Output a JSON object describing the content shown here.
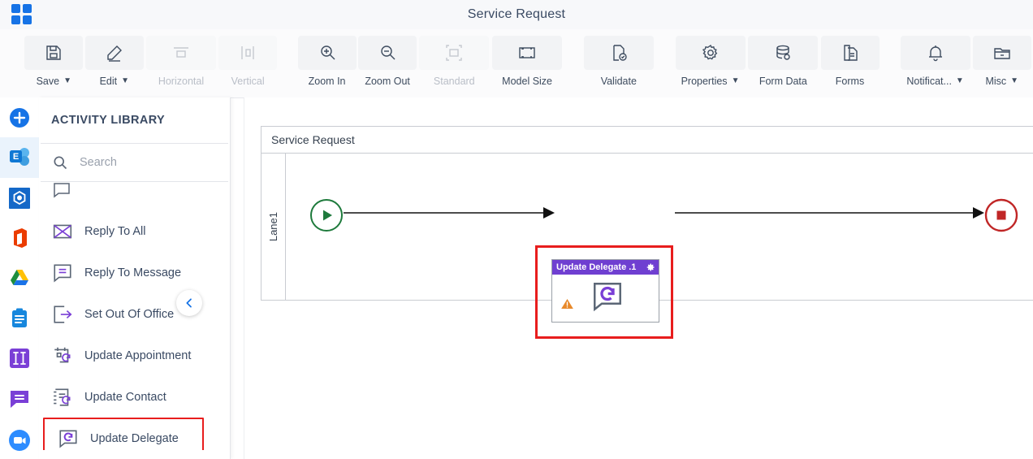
{
  "titlebar": {
    "app_grid_icon": "grid-apps-icon",
    "title": "Service Request"
  },
  "toolbar": {
    "items": [
      {
        "label": "Save",
        "icon": "save-icon",
        "caret": "⌄",
        "disabled": false
      },
      {
        "label": "Edit",
        "icon": "edit-pencil-icon",
        "caret": "⌄",
        "disabled": false
      },
      {
        "label": "Horizontal",
        "icon": "horizontal-align-icon",
        "caret": "",
        "disabled": true
      },
      {
        "label": "Vertical",
        "icon": "vertical-align-icon",
        "caret": "",
        "disabled": true
      },
      {
        "label": "Zoom In",
        "icon": "zoom-in-icon",
        "caret": "",
        "disabled": false
      },
      {
        "label": "Zoom Out",
        "icon": "zoom-out-icon",
        "caret": "",
        "disabled": false
      },
      {
        "label": "Standard",
        "icon": "standard-size-icon",
        "caret": "",
        "disabled": true
      },
      {
        "label": "Model Size",
        "icon": "model-size-icon",
        "caret": "",
        "disabled": false
      },
      {
        "label": "Validate",
        "icon": "validate-icon",
        "caret": "",
        "disabled": false
      },
      {
        "label": "Properties",
        "icon": "gear-icon",
        "caret": "⌄",
        "disabled": false
      },
      {
        "label": "Form Data",
        "icon": "database-icon",
        "caret": "",
        "disabled": false
      },
      {
        "label": "Forms",
        "icon": "document-icon",
        "caret": "",
        "disabled": false
      },
      {
        "label": "Notificat...",
        "icon": "bell-icon",
        "caret": "⌄",
        "disabled": false
      },
      {
        "label": "Misc",
        "icon": "folder-icon",
        "caret": "⌄",
        "disabled": false
      }
    ]
  },
  "rail": {
    "items": [
      {
        "name": "add-button",
        "icon": "plus-circle-icon",
        "color": "#1673e6",
        "selected": false
      },
      {
        "name": "exchange-app",
        "icon": "exchange-icon",
        "color": "#0f78d4",
        "selected": true
      },
      {
        "name": "sharepoint-app",
        "icon": "hexagon-icon",
        "color": "#1468c8",
        "selected": false
      },
      {
        "name": "office-app",
        "icon": "office-icon",
        "color": "#eb3c00",
        "selected": false
      },
      {
        "name": "google-drive-app",
        "icon": "google-drive-icon",
        "color": "#1a73e8",
        "selected": false
      },
      {
        "name": "clipboard-app",
        "icon": "clipboard-icon",
        "color": "#1787dd",
        "selected": false
      },
      {
        "name": "columns-app",
        "icon": "columns-icon",
        "color": "#7a3fd6",
        "selected": false
      },
      {
        "name": "chat-app",
        "icon": "chat-bubble-icon",
        "color": "#7a3fd6",
        "selected": false
      },
      {
        "name": "zoom-app",
        "icon": "video-camera-icon",
        "color": "#2d8cff",
        "selected": false
      }
    ]
  },
  "panel": {
    "title": "ACTIVITY LIBRARY",
    "search": {
      "placeholder": "Search",
      "value": "",
      "icon": "search-icon"
    },
    "collapse_icon": "chevron-left-icon",
    "items": [
      {
        "label": "",
        "icon": "chat-partial-icon",
        "highlighted": false
      },
      {
        "label": "Reply To All",
        "icon": "envelope-reply-icon",
        "highlighted": false
      },
      {
        "label": "Reply To Message",
        "icon": "message-reply-icon",
        "highlighted": false
      },
      {
        "label": "Set Out Of Office",
        "icon": "out-of-office-icon",
        "highlighted": false
      },
      {
        "label": "Update Appointment",
        "icon": "calendar-refresh-icon",
        "highlighted": false
      },
      {
        "label": "Update Contact",
        "icon": "contact-refresh-icon",
        "highlighted": false
      },
      {
        "label": "Update Delegate",
        "icon": "delegate-refresh-icon",
        "highlighted": true
      }
    ]
  },
  "canvas": {
    "pool_title": "Service Request",
    "lane_label": "Lane1",
    "start_event": {
      "name": "start-event",
      "color": "#1e7a3c"
    },
    "end_event": {
      "name": "end-event",
      "color": "#c02626"
    },
    "node": {
      "title": "Update Delegate .1",
      "header_color": "#6f3fd1",
      "gear_icon": "gear-icon",
      "warning_icon": "warning-triangle-icon",
      "glyph_icon": "delegate-refresh-icon",
      "selection_color": "#e81d1d"
    }
  },
  "colors": {
    "accent_blue": "#1673e6",
    "purple": "#6f3fd1",
    "highlight_red": "#e81d1d",
    "green": "#1e7a3c",
    "warn_orange": "#e8892a"
  }
}
